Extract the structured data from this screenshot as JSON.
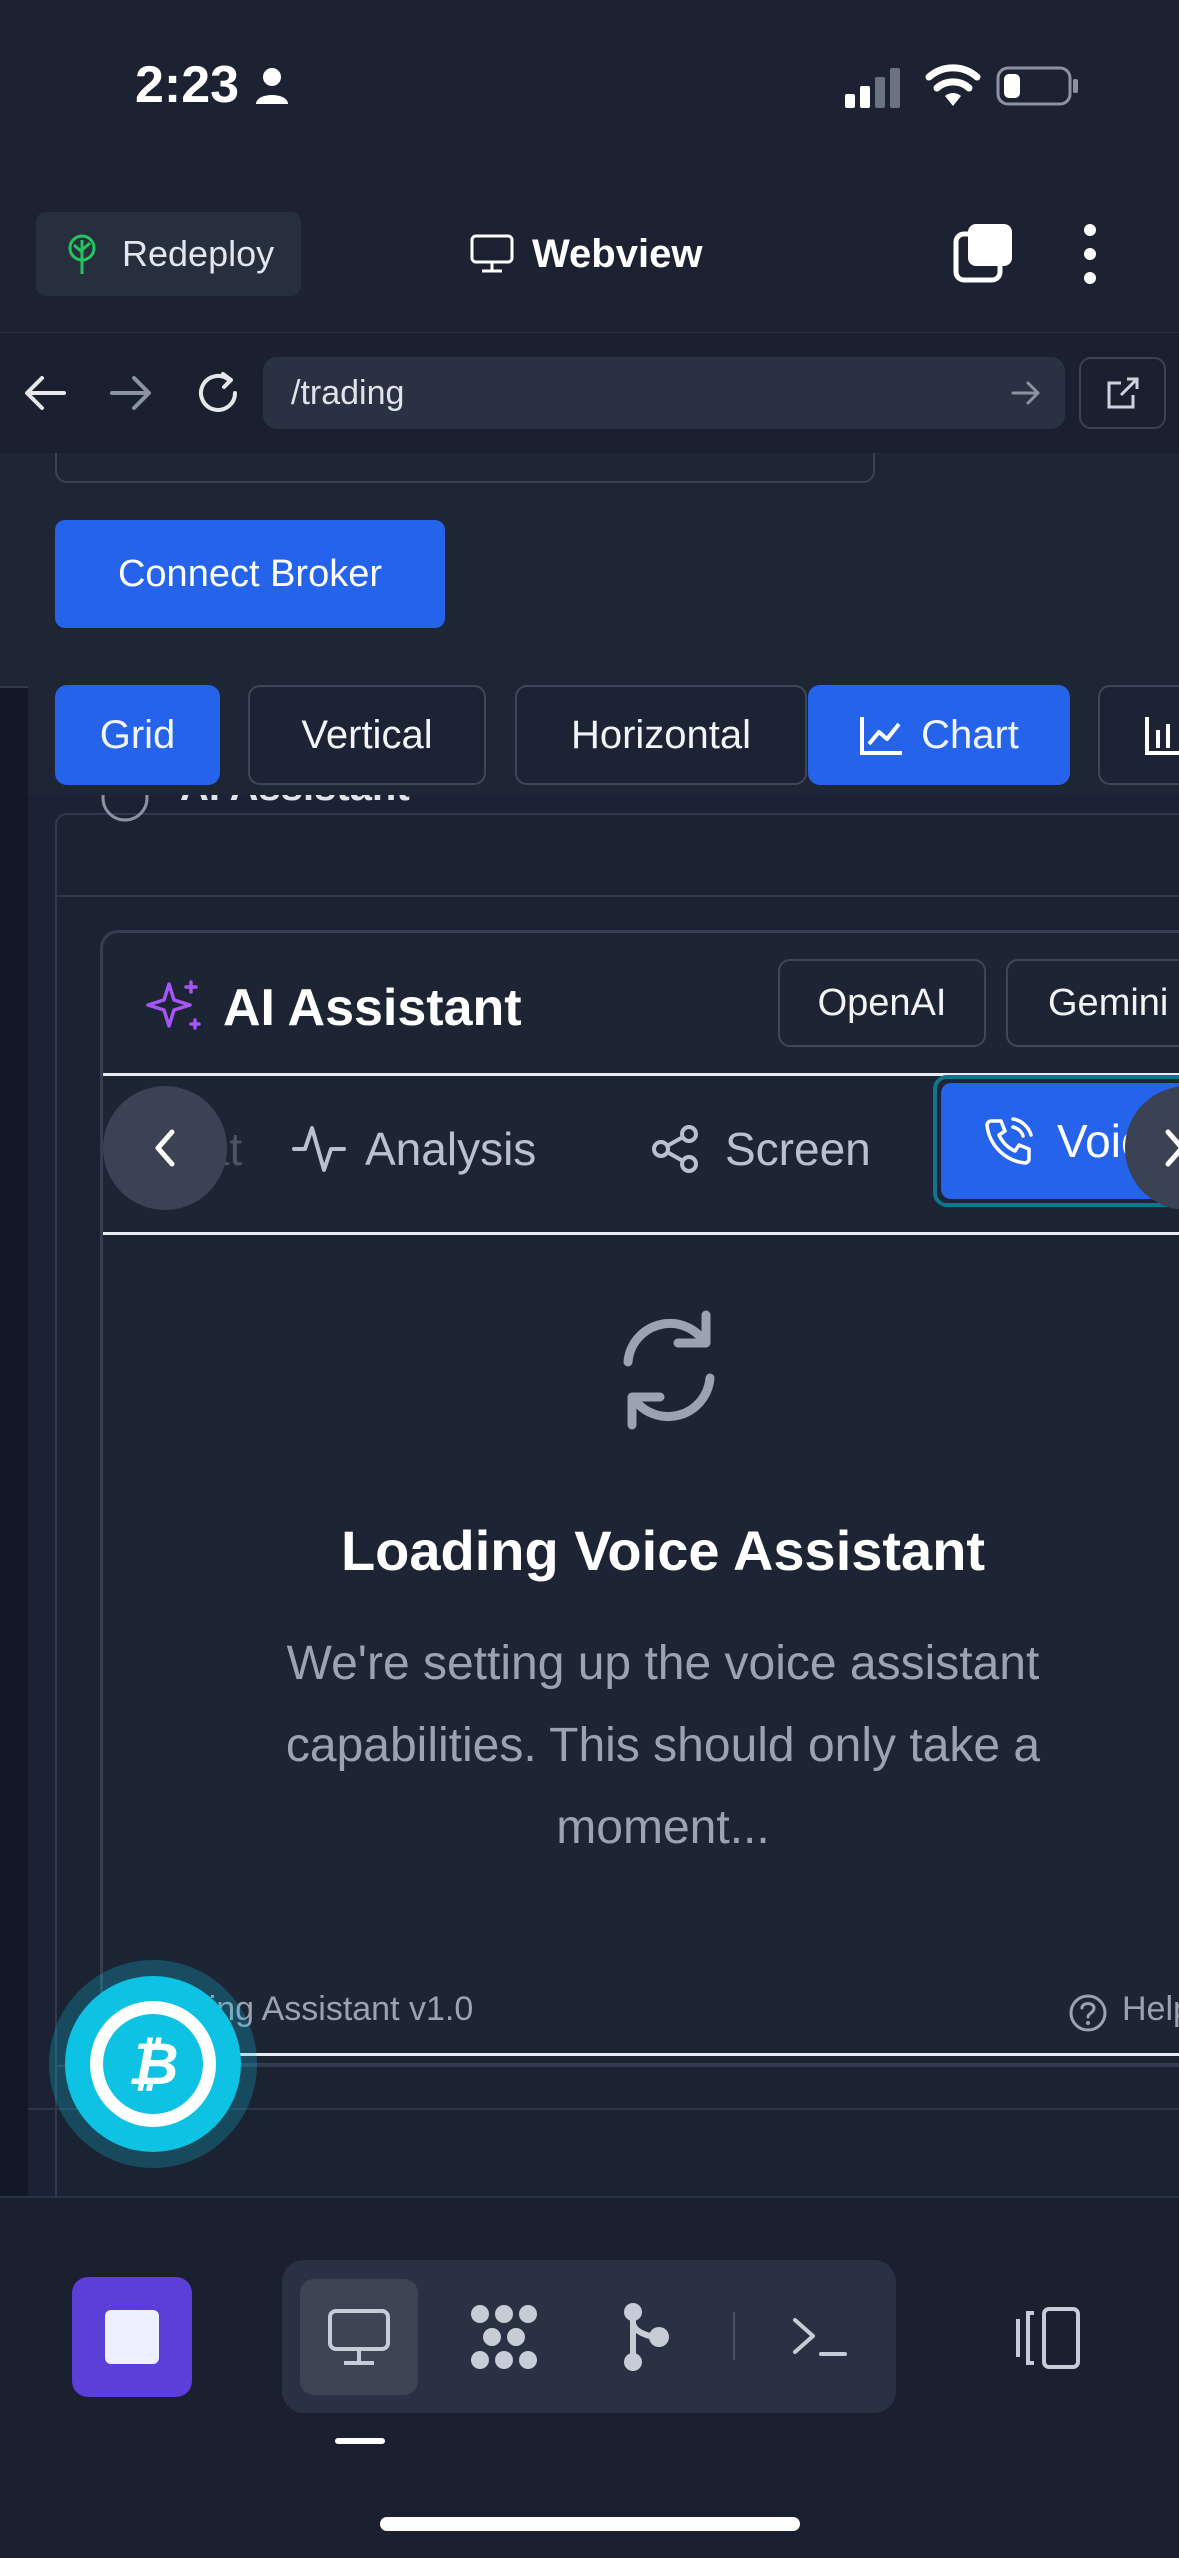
{
  "status_bar": {
    "time": "2:23"
  },
  "app_header": {
    "redeploy_label": "Redeploy",
    "title": "Webview"
  },
  "browser": {
    "url": "/trading"
  },
  "page": {
    "connect_broker": "Connect Broker",
    "layout_buttons": [
      "Grid",
      "Vertical",
      "Horizontal",
      "Chart"
    ],
    "outer_panel_title": "AI Assistant",
    "assistant": {
      "title": "AI Assistant",
      "providers": [
        "OpenAI",
        "Gemini"
      ],
      "tabs": {
        "chat": "Chat",
        "analysis": "Analysis",
        "screen": "Screen",
        "voice": "Voice"
      },
      "loading_title": "Loading Voice Assistant",
      "loading_desc": "We're setting up the voice assistant capabilities. This should only take a moment...",
      "footer_left": "Trading Assistant v1.0",
      "footer_right": "Help"
    }
  },
  "colors": {
    "accent": "#2563eb",
    "bitcoin_fab": "#0ec2e3",
    "stop_button": "#5b3fd8"
  }
}
